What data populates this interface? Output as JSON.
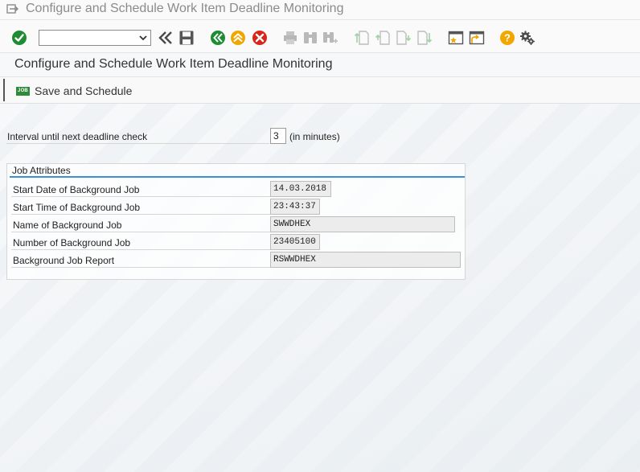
{
  "window": {
    "title": "Configure and Schedule Work Item Deadline Monitoring",
    "menu_icon": "menu-icon"
  },
  "toolbar": {
    "command_field_value": "",
    "icons": [
      "enter-icon",
      "back-double-chevron-icon",
      "save-icon",
      "back-icon",
      "exit-icon",
      "cancel-icon",
      "print-icon",
      "find-icon",
      "find-next-icon",
      "first-page-icon",
      "previous-page-icon",
      "next-page-icon",
      "last-page-icon",
      "create-session-icon",
      "create-shortcut-icon",
      "help-icon",
      "settings-icon"
    ]
  },
  "page": {
    "title": "Configure and Schedule Work Item Deadline Monitoring"
  },
  "app_toolbar": {
    "save_schedule_icon_text": "JOB",
    "save_schedule_label": "Save and Schedule"
  },
  "form": {
    "interval_label": "Interval until next deadline check",
    "interval_value": "3",
    "interval_unit": "(in minutes)"
  },
  "job_attributes": {
    "title": "Job Attributes",
    "rows": [
      {
        "label": "Start Date of Background Job",
        "value": "14.03.2018"
      },
      {
        "label": "Start Time of Background Job",
        "value": "23:43:37"
      },
      {
        "label": "Name of Background Job",
        "value": "SWWDHEX"
      },
      {
        "label": "Number of Background Job",
        "value": "23405100"
      },
      {
        "label": "Background Job Report",
        "value": "RSWWDHEX"
      }
    ]
  },
  "colors": {
    "enter_green": "#1e8c32",
    "back_green": "#1e8c32",
    "exit_yellow": "#f0a800",
    "cancel_red": "#d9261c",
    "help_orange": "#f0a800",
    "group_accent": "#3a8fd6"
  }
}
